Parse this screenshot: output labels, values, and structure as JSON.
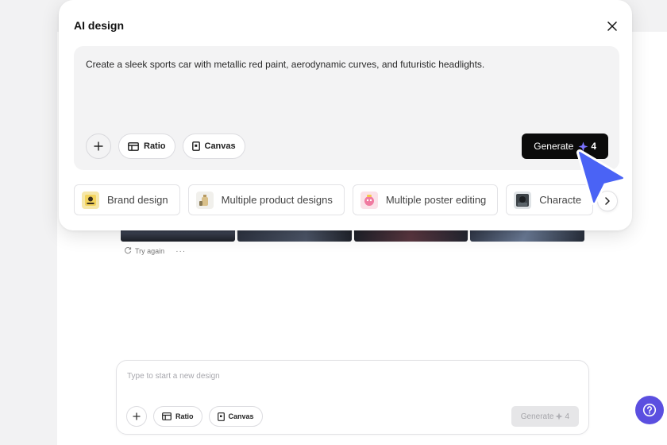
{
  "modal": {
    "title": "AI design",
    "prompt": "Create a sleek sports car with metallic red paint, aerodynamic curves, and futuristic headlights.",
    "tools": {
      "ratio_label": "Ratio",
      "canvas_label": "Canvas"
    },
    "generate": {
      "label": "Generate",
      "credits": "4"
    },
    "suggestions": [
      {
        "label": "Brand design",
        "icon": "brand-thumbnail"
      },
      {
        "label": "Multiple product designs",
        "icon": "product-thumbnail"
      },
      {
        "label": "Multiple poster editing",
        "icon": "poster-thumbnail"
      },
      {
        "label": "Characte",
        "icon": "character-thumbnail"
      }
    ]
  },
  "history": {
    "try_again_label": "Try again",
    "more_label": "···"
  },
  "composer": {
    "placeholder": "Type to start a new design",
    "ratio_label": "Ratio",
    "canvas_label": "Canvas",
    "generate_label": "Generate",
    "generate_credits": "4"
  },
  "colors": {
    "accent": "#5b4fe0",
    "cursor": "#4a63f5",
    "generate_bg": "#0b0b0b"
  },
  "icons": [
    "close-icon",
    "plus-icon",
    "ratio-icon",
    "canvas-icon",
    "sparkle-icon",
    "refresh-icon",
    "chevron-right-icon",
    "help-icon",
    "pointer-cursor-icon"
  ]
}
